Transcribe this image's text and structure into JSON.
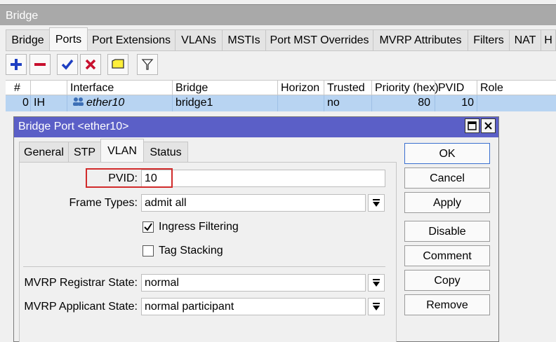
{
  "outer_window": {
    "title": "Bridge"
  },
  "outer_tabs": [
    "Bridge",
    "Ports",
    "Port Extensions",
    "VLANs",
    "MSTIs",
    "Port MST Overrides",
    "MVRP Attributes",
    "Filters",
    "NAT",
    "H"
  ],
  "toolbar": [
    "plus-icon",
    "minus-icon",
    "check-icon",
    "x-icon",
    "comment-icon",
    "filter-icon"
  ],
  "table": {
    "headers": [
      "#",
      "",
      "Interface",
      "Bridge",
      "Horizon",
      "Trusted",
      "Priority (hex)",
      "PVID",
      "Role"
    ],
    "row": {
      "index": "0",
      "flags": "IH",
      "interface": "ether10",
      "bridge": "bridge1",
      "horizon": "",
      "trusted": "no",
      "priority": "80",
      "pvid": "10",
      "role": ""
    }
  },
  "dialog": {
    "title": "Bridge Port <ether10>",
    "tabs": [
      "General",
      "STP",
      "VLAN",
      "Status"
    ],
    "active_tab": "VLAN",
    "pvid_label": "PVID:",
    "pvid_value": "10",
    "frame_types_label": "Frame Types:",
    "frame_types_value": "admit all",
    "ingress_filtering_label": "Ingress Filtering",
    "ingress_filtering_checked": true,
    "tag_stacking_label": "Tag Stacking",
    "tag_stacking_checked": false,
    "mvrp_registrar_label": "MVRP Registrar State:",
    "mvrp_registrar_value": "normal",
    "mvrp_applicant_label": "MVRP Applicant State:",
    "mvrp_applicant_value": "normal participant",
    "buttons": {
      "ok": "OK",
      "cancel": "Cancel",
      "apply": "Apply",
      "disable": "Disable",
      "comment": "Comment",
      "copy": "Copy",
      "remove": "Remove"
    }
  },
  "colors": {
    "dialog_title": "#5b5fc7",
    "row_selected": "#b8d4f2",
    "highlight": "#d12b2b"
  }
}
